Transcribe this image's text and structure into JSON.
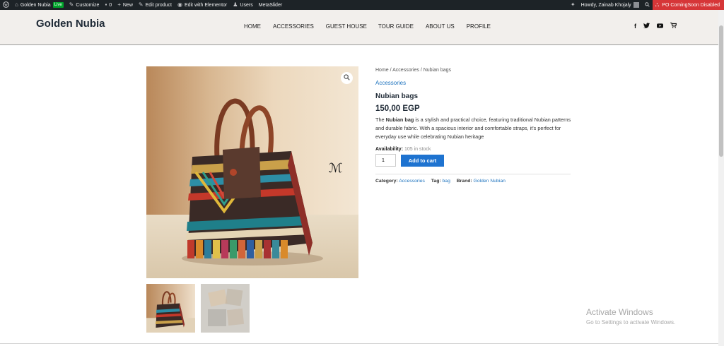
{
  "admin_bar": {
    "site_name": "Golden Nubia",
    "live_badge": "Live",
    "customize": "Customize",
    "comments_count": "0",
    "new": "New",
    "edit_product": "Edit product",
    "edit_elementor": "Edit with Elementor",
    "users": "Users",
    "metaslider": "MetaSlider",
    "howdy": "Howdy, Zainab Khojaly",
    "coming_soon": "PO ComingSoon Disabled"
  },
  "header": {
    "site_title": "Golden Nubia",
    "nav": [
      "HOME",
      "ACCESSORIES",
      "GUEST HOUSE",
      "TOUR GUIDE",
      "ABOUT US",
      "PROFILE"
    ],
    "social": [
      "facebook-icon",
      "twitter-icon",
      "youtube-icon",
      "cart-icon"
    ]
  },
  "product": {
    "breadcrumb": {
      "home": "Home",
      "sep1": " / ",
      "category": "Accessories",
      "sep2": " / ",
      "current": "Nubian bags"
    },
    "category_link": "Accessories",
    "title": "Nubian bags",
    "price": "150,00 EGP",
    "desc_prefix": "The ",
    "desc_bold": "Nubian bag",
    "desc_rest": " is a stylish and practical choice, featuring traditional Nubian patterns and durable fabric. With a spacious interior and comfortable straps, it's perfect for everyday use while celebrating Nubian heritage",
    "availability_label": "Availability:",
    "stock": "105 in stock",
    "qty_value": "1",
    "add_to_cart": "Add to cart",
    "meta": {
      "category_label": "Category:",
      "category_value": "Accessories",
      "tag_label": "Tag:",
      "tag_value": "bag",
      "brand_label": "Brand:",
      "brand_value": "Golden Nubian"
    }
  },
  "watermark": {
    "title": "Activate Windows",
    "subtitle": "Go to Settings to activate Windows."
  },
  "colors": {
    "admin_bar": "#1d2327",
    "accent": "#1e73d0",
    "coming_soon": "#d63638",
    "header_bg": "#f2efec"
  }
}
